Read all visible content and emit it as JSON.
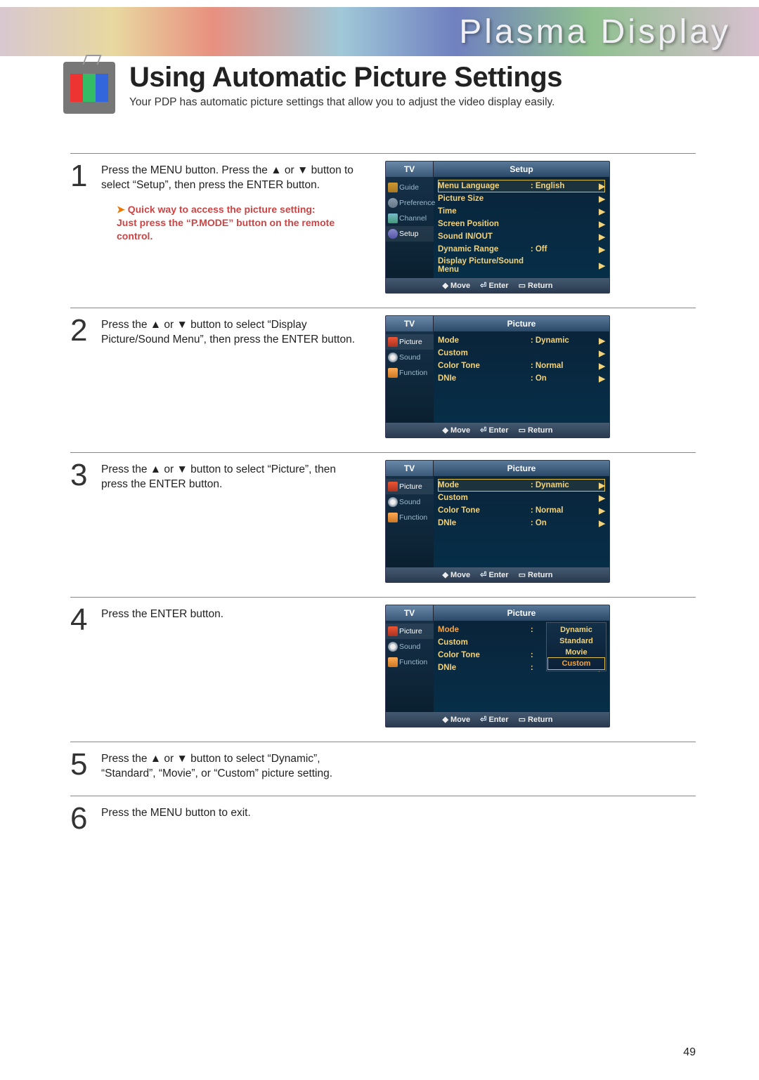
{
  "banner_text": "Plasma Display",
  "page_title": "Using Automatic Picture Settings",
  "subtitle": "Your PDP has automatic picture settings that allow you to adjust the video display easily.",
  "page_number": "49",
  "steps": [
    {
      "num": "1",
      "text": "Press the MENU button. Press the ▲ or ▼ button to select “Setup”, then press the ENTER button.",
      "hint_title": "Quick way to access the picture setting:",
      "hint_body": "Just press the “P.MODE” button on the remote control."
    },
    {
      "num": "2",
      "text": "Press the ▲ or ▼ button to select “Display Picture/Sound Menu”, then press the ENTER button."
    },
    {
      "num": "3",
      "text": "Press the ▲ or ▼ button to select “Picture”, then press the ENTER button."
    },
    {
      "num": "4",
      "text": "Press the ENTER button."
    },
    {
      "num": "5",
      "text": "Press the ▲ or ▼ button to select “Dynamic”, “Standard”, “Movie”, or “Custom” picture setting."
    },
    {
      "num": "6",
      "text": "Press the MENU button to exit."
    }
  ],
  "osd_common": {
    "tv": "TV",
    "foot_move": "Move",
    "foot_enter": "Enter",
    "foot_return": "Return"
  },
  "osd1": {
    "title": "Setup",
    "side": [
      "Guide",
      "Preference",
      "Channel",
      "Setup"
    ],
    "rows": [
      {
        "lbl": "Menu Language",
        "val": ": English",
        "hl": true
      },
      {
        "lbl": "Picture Size",
        "val": ""
      },
      {
        "lbl": "Time",
        "val": ""
      },
      {
        "lbl": "Screen Position",
        "val": ""
      },
      {
        "lbl": "Sound IN/OUT",
        "val": ""
      },
      {
        "lbl": "Dynamic Range",
        "val": ": Off"
      },
      {
        "lbl": "Display Picture/Sound Menu",
        "val": ""
      }
    ]
  },
  "osd2": {
    "title": "Picture",
    "side": [
      "Picture",
      "Sound",
      "Function"
    ],
    "rows": [
      {
        "lbl": "Mode",
        "val": ": Dynamic"
      },
      {
        "lbl": "Custom",
        "val": ""
      },
      {
        "lbl": "Color Tone",
        "val": ": Normal"
      },
      {
        "lbl": "DNIe",
        "val": ": On"
      }
    ]
  },
  "osd3": {
    "title": "Picture",
    "side": [
      "Picture",
      "Sound",
      "Function"
    ],
    "rows": [
      {
        "lbl": "Mode",
        "val": ": Dynamic",
        "hl": true
      },
      {
        "lbl": "Custom",
        "val": ""
      },
      {
        "lbl": "Color Tone",
        "val": ": Normal"
      },
      {
        "lbl": "DNIe",
        "val": ": On"
      }
    ]
  },
  "osd4": {
    "title": "Picture",
    "side": [
      "Picture",
      "Sound",
      "Function"
    ],
    "rows": [
      {
        "lbl": "Mode",
        "val": ":",
        "orange": true
      },
      {
        "lbl": "Custom",
        "val": ""
      },
      {
        "lbl": "Color Tone",
        "val": ":"
      },
      {
        "lbl": "DNIe",
        "val": ":"
      }
    ],
    "popup": [
      "Dynamic",
      "Standard",
      "Movie",
      "Custom"
    ],
    "popup_sel": 3
  }
}
